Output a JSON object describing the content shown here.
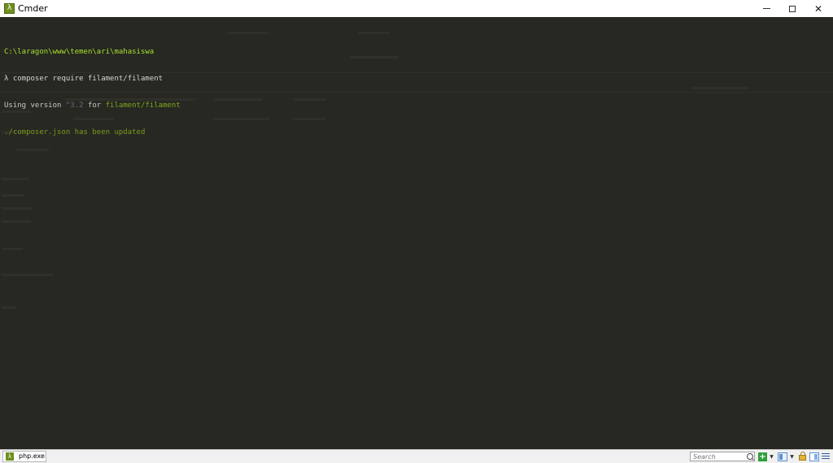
{
  "window": {
    "title": "Cmder",
    "app_icon_glyph": "λ",
    "buttons": {
      "minimize": "minimize-icon",
      "maximize": "maximize-icon",
      "close": "close-icon",
      "close_glyph": "✕"
    }
  },
  "console": {
    "background": "#272822",
    "lines": [
      {
        "path": "C:\\laragon\\www\\temen\\ari\\mahasiswa"
      },
      {
        "prompt": "λ",
        "command": "composer require filament/filament"
      },
      {
        "pre": "Using version ",
        "version": "^3.2",
        "mid": " for ",
        "package": "filament/filament"
      },
      {
        "text": "./composer.json has been updated"
      }
    ]
  },
  "statusbar": {
    "tab_icon_glyph": "λ",
    "tab_label": "php.exe",
    "search_placeholder": "Search",
    "icons": [
      "new-console-icon",
      "dropdown-arrow-icon",
      "split-view-icon",
      "dropdown-arrow-icon",
      "lock-icon",
      "panel-icon",
      "menu-icon"
    ],
    "new_glyph": "+",
    "arrow_glyph": "▼"
  }
}
